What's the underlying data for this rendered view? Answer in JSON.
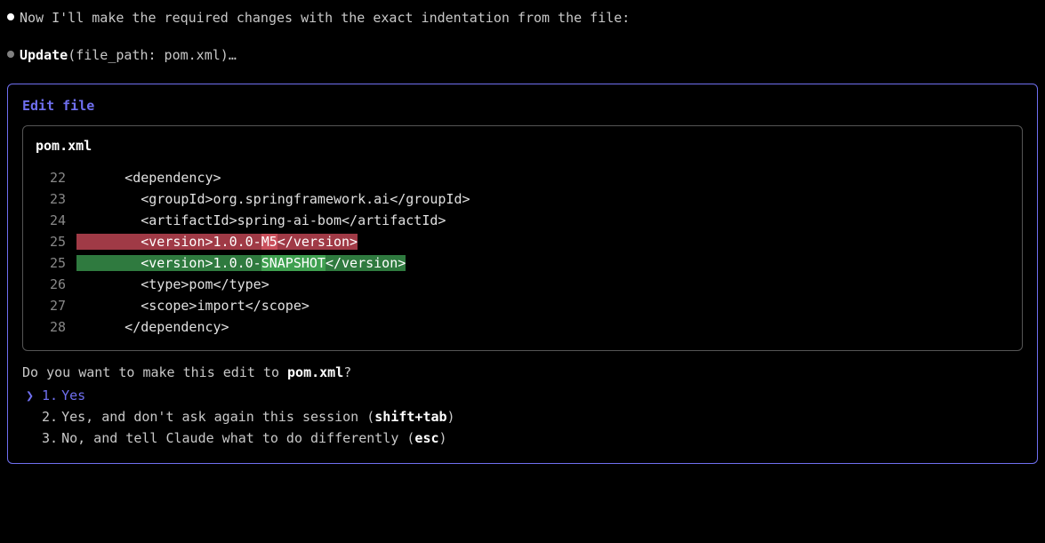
{
  "message_text": "Now I'll make the required changes with the exact indentation from the file:",
  "tool_call": {
    "name": "Update",
    "args": "(file_path: pom.xml)",
    "ellipsis": "…"
  },
  "panel": {
    "title": "Edit file",
    "filename": "pom.xml",
    "lines": [
      {
        "num": "22",
        "content": "      <dependency>"
      },
      {
        "num": "23",
        "content": "        <groupId>org.springframework.ai</groupId>"
      },
      {
        "num": "24",
        "content": "        <artifactId>spring-ai-bom</artifactId>"
      },
      {
        "num": "25",
        "prefix": "        <version>1.0.0-",
        "frag": "M5",
        "suffix": "</version>",
        "kind": "del"
      },
      {
        "num": "25",
        "prefix": "        <version>1.0.0-",
        "frag": "SNAPSHOT",
        "suffix": "</version>",
        "kind": "add"
      },
      {
        "num": "26",
        "content": "        <type>pom</type>"
      },
      {
        "num": "27",
        "content": "        <scope>import</scope>"
      },
      {
        "num": "28",
        "content": "      </dependency>"
      }
    ]
  },
  "prompt": {
    "question_prefix": "Do you want to make this edit to ",
    "question_target": "pom.xml",
    "question_suffix": "?",
    "options": [
      {
        "num": "1.",
        "label": "Yes",
        "selected": true
      },
      {
        "num": "2.",
        "label": "Yes, and don't ask again this session (",
        "kbd": "shift+tab",
        "after": ")"
      },
      {
        "num": "3.",
        "label": "No, and tell Claude what to do differently (",
        "kbd": "esc",
        "after": ")"
      }
    ]
  }
}
